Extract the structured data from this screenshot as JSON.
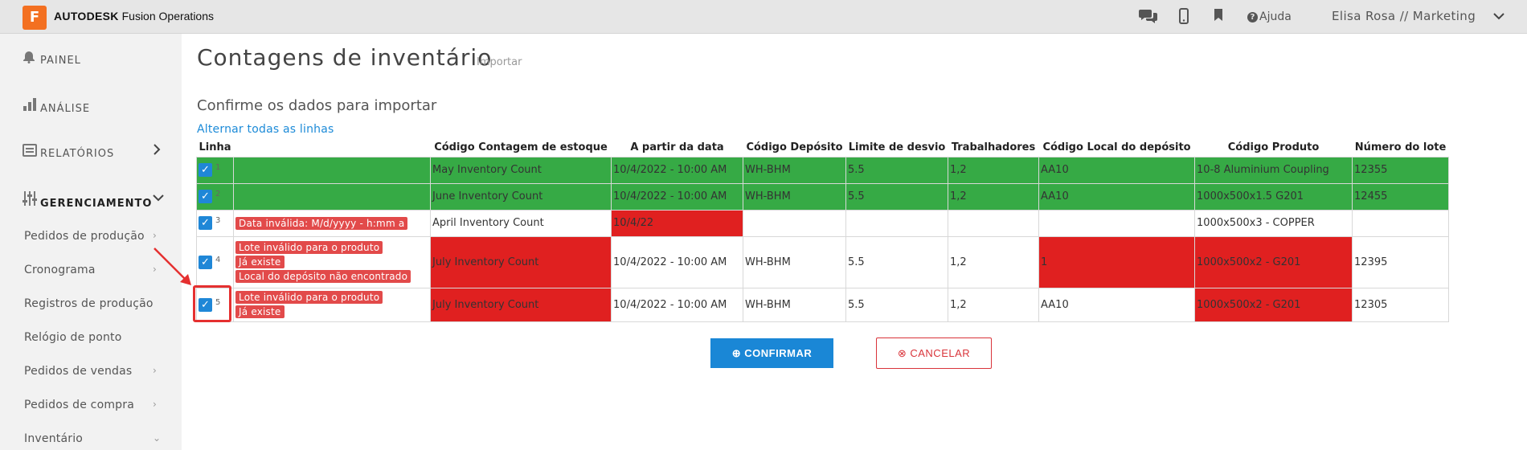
{
  "app": {
    "logo_letter": "F",
    "brand_bold": "AUTODESK",
    "brand_rest": " Fusion Operations"
  },
  "header": {
    "help_label": "Ajuda",
    "user": "Elisa Rosa // Marketing"
  },
  "sidebar": {
    "main": [
      {
        "label": "PAINEL"
      },
      {
        "label": "ANÁLISE"
      },
      {
        "label": "RELATÓRIOS"
      },
      {
        "label": "GERENCIAMENTO"
      }
    ],
    "sub": [
      {
        "label": "Pedidos de produção"
      },
      {
        "label": "Cronograma"
      },
      {
        "label": "Registros de produção"
      },
      {
        "label": "Relógio de ponto"
      },
      {
        "label": "Pedidos de vendas"
      },
      {
        "label": "Pedidos de compra"
      },
      {
        "label": "Inventário"
      }
    ]
  },
  "page": {
    "title": "Contagens de inventário",
    "import_tag": "Importar",
    "subtitle": "Confirme os dados para importar",
    "toggle_all": "Alternar todas as linhas"
  },
  "table": {
    "headers": [
      "Linha",
      "",
      "Código Contagem de estoque",
      "A partir da data",
      "Código Depósito",
      "Limite de desvio",
      "Trabalhadores",
      "Código Local do depósito",
      "Código Produto",
      "Número do lote"
    ],
    "rows": [
      {
        "num": "1",
        "checked": true,
        "errors": [],
        "cells": [
          "May Inventory Count",
          "10/4/2022 - 10:00 AM",
          "WH-BHM",
          "5.5",
          "1,2",
          "AA10",
          "10-8 Aluminium Coupling",
          "12355"
        ]
      },
      {
        "num": "2",
        "checked": true,
        "errors": [],
        "cells": [
          "June Inventory Count",
          "10/4/2022 - 10:00 AM",
          "WH-BHM",
          "5.5",
          "1,2",
          "AA10",
          "1000x500x1.5 G201",
          "12455"
        ]
      },
      {
        "num": "3",
        "checked": true,
        "errors": [
          "Data inválida: M/d/yyyy - h:mm a"
        ],
        "cells": [
          "April Inventory Count",
          "10/4/22",
          "",
          "",
          "",
          "",
          "1000x500x3 - COPPER",
          ""
        ]
      },
      {
        "num": "4",
        "checked": true,
        "errors": [
          "Lote inválido para o produto",
          "Já existe",
          "Local do depósito não encontrado"
        ],
        "cells": [
          "July Inventory Count",
          "10/4/2022 - 10:00 AM",
          "WH-BHM",
          "5.5",
          "1,2",
          "1",
          "1000x500x2 - G201",
          "12395"
        ]
      },
      {
        "num": "5",
        "checked": true,
        "errors": [
          "Lote inválido para o produto",
          "Já existe"
        ],
        "cells": [
          "July Inventory Count",
          "10/4/2022 - 10:00 AM",
          "WH-BHM",
          "5.5",
          "1,2",
          "AA10",
          "1000x500x2 - G201",
          "12305"
        ]
      }
    ]
  },
  "buttons": {
    "confirm": "CONFIRMAR",
    "cancel": "CANCELAR"
  },
  "colors": {
    "ok_row": "#36aa45",
    "error_cell": "#e02020",
    "primary": "#1a87d6",
    "danger": "#d9343a",
    "brand": "#f37021"
  }
}
